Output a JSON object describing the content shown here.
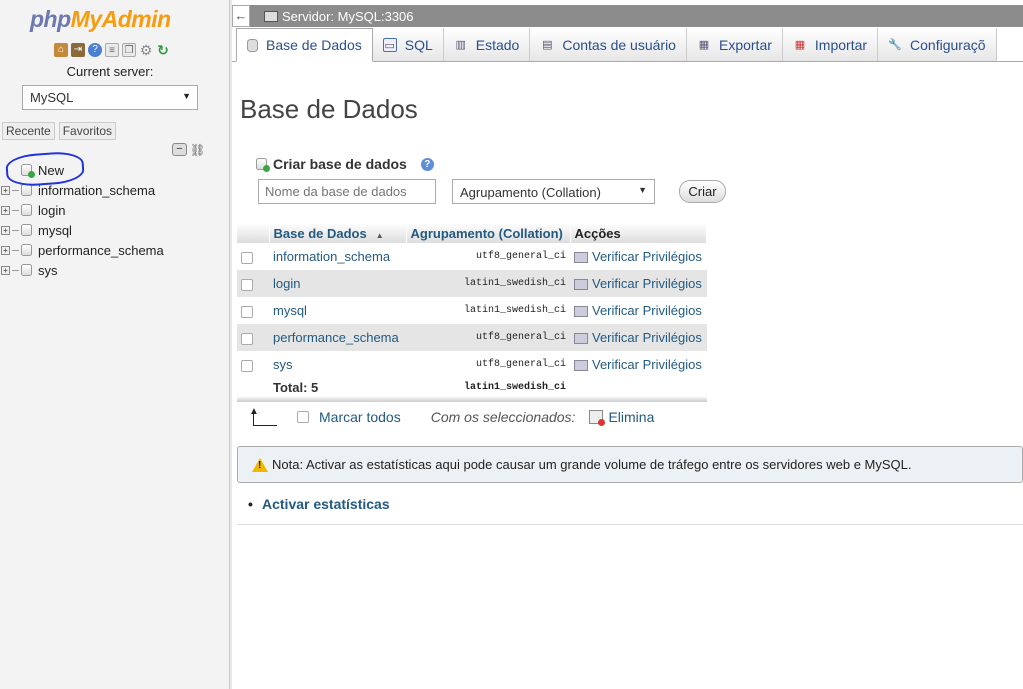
{
  "logo": {
    "part1": "php",
    "part2": "MyAdmin"
  },
  "sidebar": {
    "current_server_label": "Current server:",
    "server_value": "MySQL",
    "recent_tab": "Recente",
    "favorites_tab": "Favoritos",
    "new_label": "New",
    "databases": [
      "information_schema",
      "login",
      "mysql",
      "performance_schema",
      "sys"
    ]
  },
  "header": {
    "back_symbol": "←",
    "server_title": "Servidor: MySQL:3306"
  },
  "tabs": [
    {
      "label": "Base de Dados",
      "icon": "database-icon"
    },
    {
      "label": "SQL",
      "icon": "sql-icon"
    },
    {
      "label": "Estado",
      "icon": "status-icon"
    },
    {
      "label": "Contas de usuário",
      "icon": "users-icon"
    },
    {
      "label": "Exportar",
      "icon": "export-icon"
    },
    {
      "label": "Importar",
      "icon": "import-icon"
    },
    {
      "label": "Configuraçõ",
      "icon": "wrench-icon"
    }
  ],
  "main": {
    "page_title": "Base de Dados",
    "create_label": "Criar base de dados",
    "db_name_placeholder": "Nome da base de dados",
    "collation_value": "Agrupamento (Collation)",
    "create_button": "Criar",
    "table": {
      "headers": [
        "Base de Dados",
        "Agrupamento (Collation)",
        "Acções"
      ],
      "rows": [
        {
          "name": "information_schema",
          "collation": "utf8_general_ci",
          "action": "Verificar Privilégios"
        },
        {
          "name": "login",
          "collation": "latin1_swedish_ci",
          "action": "Verificar Privilégios"
        },
        {
          "name": "mysql",
          "collation": "latin1_swedish_ci",
          "action": "Verificar Privilégios"
        },
        {
          "name": "performance_schema",
          "collation": "utf8_general_ci",
          "action": "Verificar Privilégios"
        },
        {
          "name": "sys",
          "collation": "utf8_general_ci",
          "action": "Verificar Privilégios"
        }
      ],
      "total_label": "Total: 5",
      "total_collation": "latin1_swedish_ci"
    },
    "mark_all": "Marcar todos",
    "with_selected": "Com os seleccionados:",
    "drop_label": "Elimina",
    "notice": "Nota: Activar as estatísticas aqui pode causar um grande volume de tráfego entre os servidores web e MySQL.",
    "stats_link": "Activar estatísticas"
  },
  "colors": {
    "logo_blue": "#6c78af",
    "logo_orange": "#f89c0e",
    "link": "#235a81",
    "annotation": "#2234d8"
  }
}
